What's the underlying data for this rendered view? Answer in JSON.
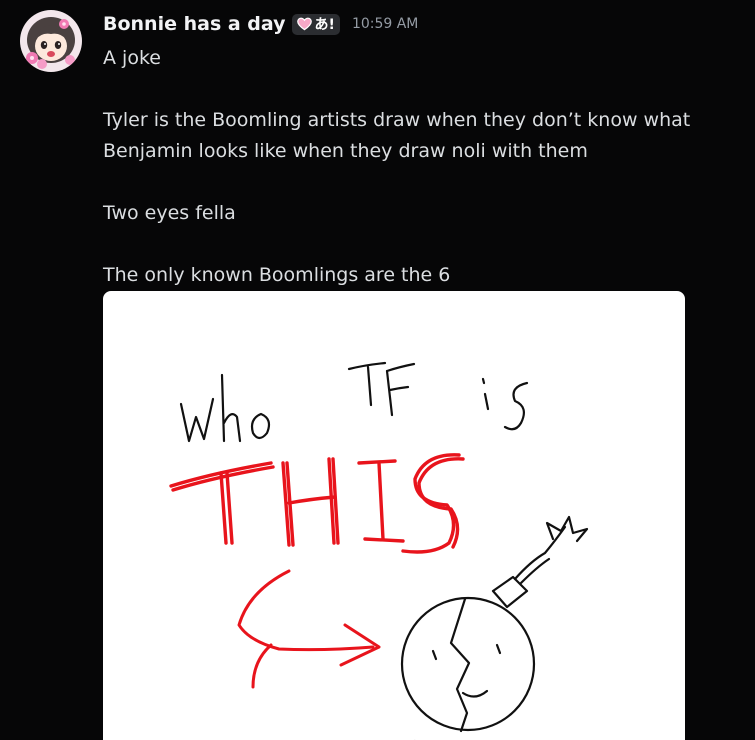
{
  "message": {
    "author": "Bonnie has a day",
    "tag_text": "あ!",
    "tag_icon": "heart-icon",
    "tag_heart_color": "#f8a9c8",
    "timestamp": "10:59 AM",
    "lines": {
      "line1": "A joke",
      "line2": "Tyler is the Boomling artists draw when they don’t know what",
      "line3": "Benjamin looks like when they draw noli with them",
      "line4": "Two eyes fella",
      "line5": "The only known Boomlings are the 6"
    },
    "attachment": {
      "drawn_text_top": "who TF is",
      "drawn_text_big": "THIS",
      "big_text_color": "#e8141c",
      "drawing_subject": "bomb-character"
    }
  }
}
